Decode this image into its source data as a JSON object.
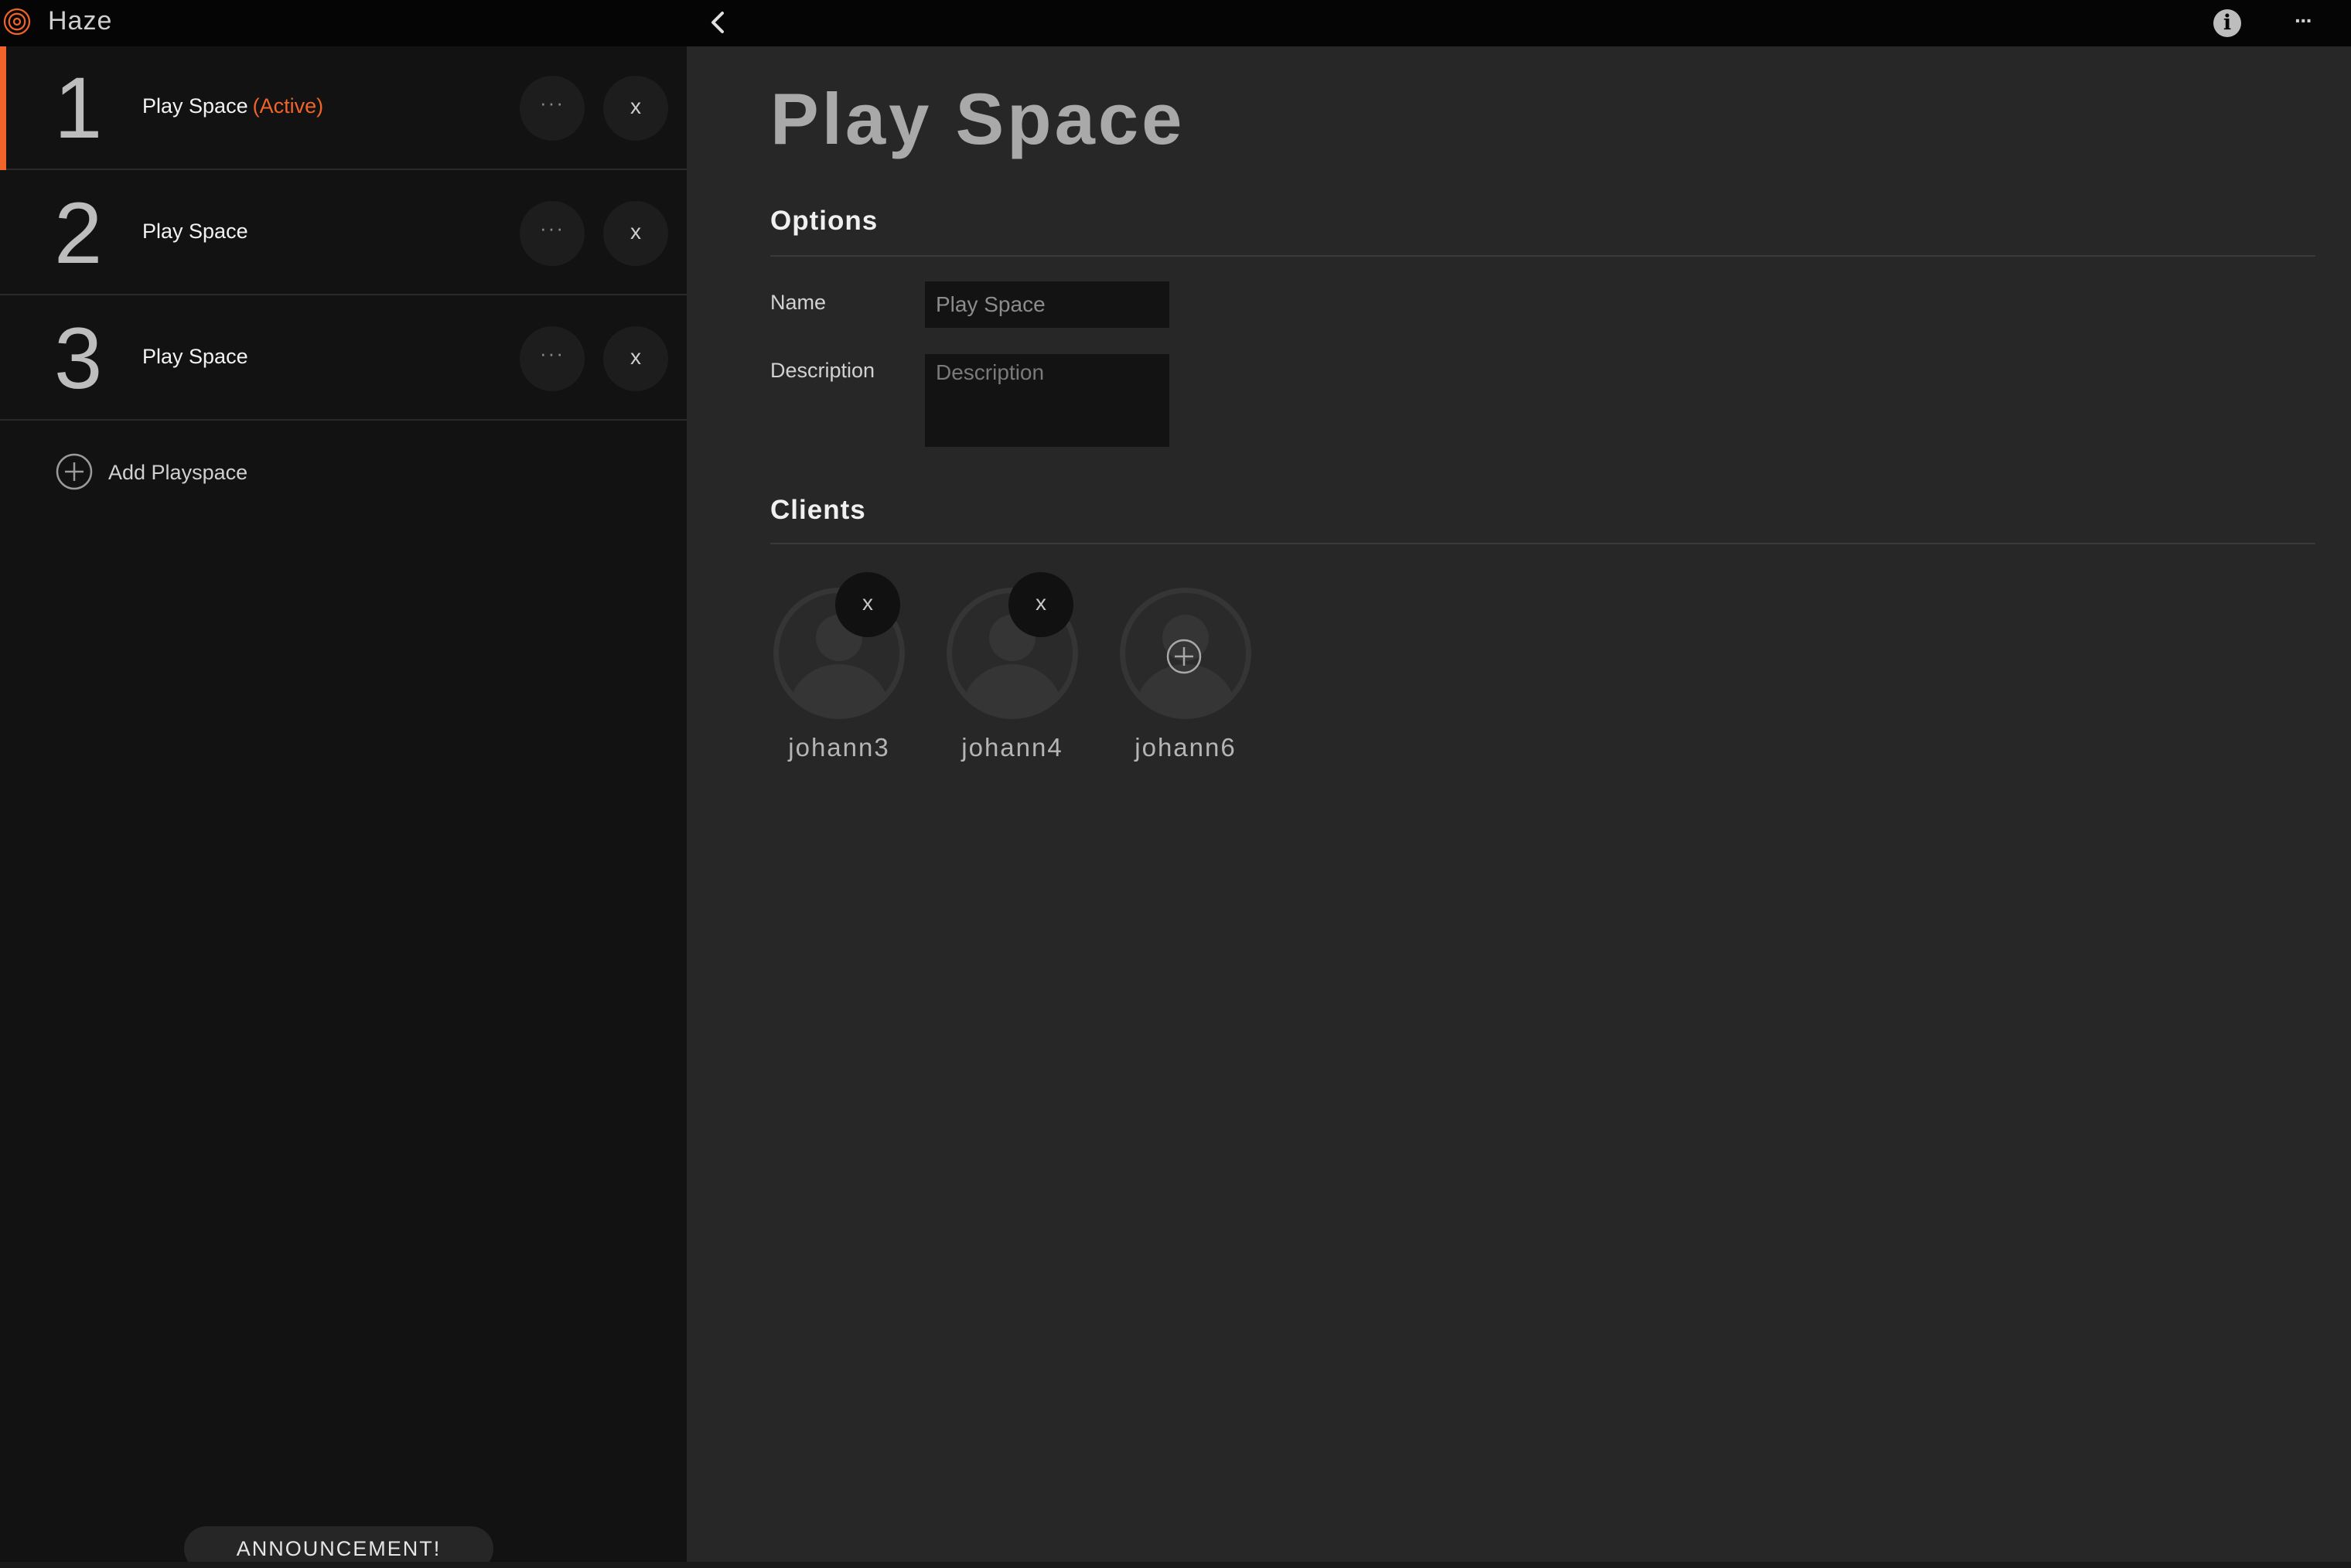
{
  "app": {
    "title": "Haze"
  },
  "sidebar": {
    "playspaces": [
      {
        "number": "1",
        "name": "Play Space",
        "status": "(Active)",
        "active": true
      },
      {
        "number": "2",
        "name": "Play Space",
        "status": "",
        "active": false
      },
      {
        "number": "3",
        "name": "Play Space",
        "status": "",
        "active": false
      }
    ],
    "row_more_glyph": "···",
    "row_close_glyph": "x",
    "add_label": "Add Playspace",
    "announcement_label": "ANNOUNCEMENT!"
  },
  "main": {
    "title": "Play Space",
    "options_heading": "Options",
    "name_label": "Name",
    "name_value": "Play Space",
    "description_label": "Description",
    "description_placeholder": "Description",
    "clients_heading": "Clients",
    "clients": [
      {
        "name": "johann3",
        "action": "remove",
        "action_glyph": "x"
      },
      {
        "name": "johann4",
        "action": "remove",
        "action_glyph": "x"
      },
      {
        "name": "johann6",
        "action": "add",
        "action_glyph": ""
      }
    ]
  },
  "topbar": {
    "info_glyph": "i",
    "more_glyph": "···"
  },
  "colors": {
    "accent": "#f0642a",
    "sidebar_bg": "#121212",
    "main_bg": "#272727",
    "topbar_bg": "#050505"
  },
  "icons": {
    "logo": "haze-spiral-logo-icon",
    "back": "chevron-left-icon",
    "info": "info-icon",
    "more": "more-dots-icon",
    "add": "plus-circle-icon",
    "client": "user-avatar-icon",
    "close": "close-icon"
  }
}
